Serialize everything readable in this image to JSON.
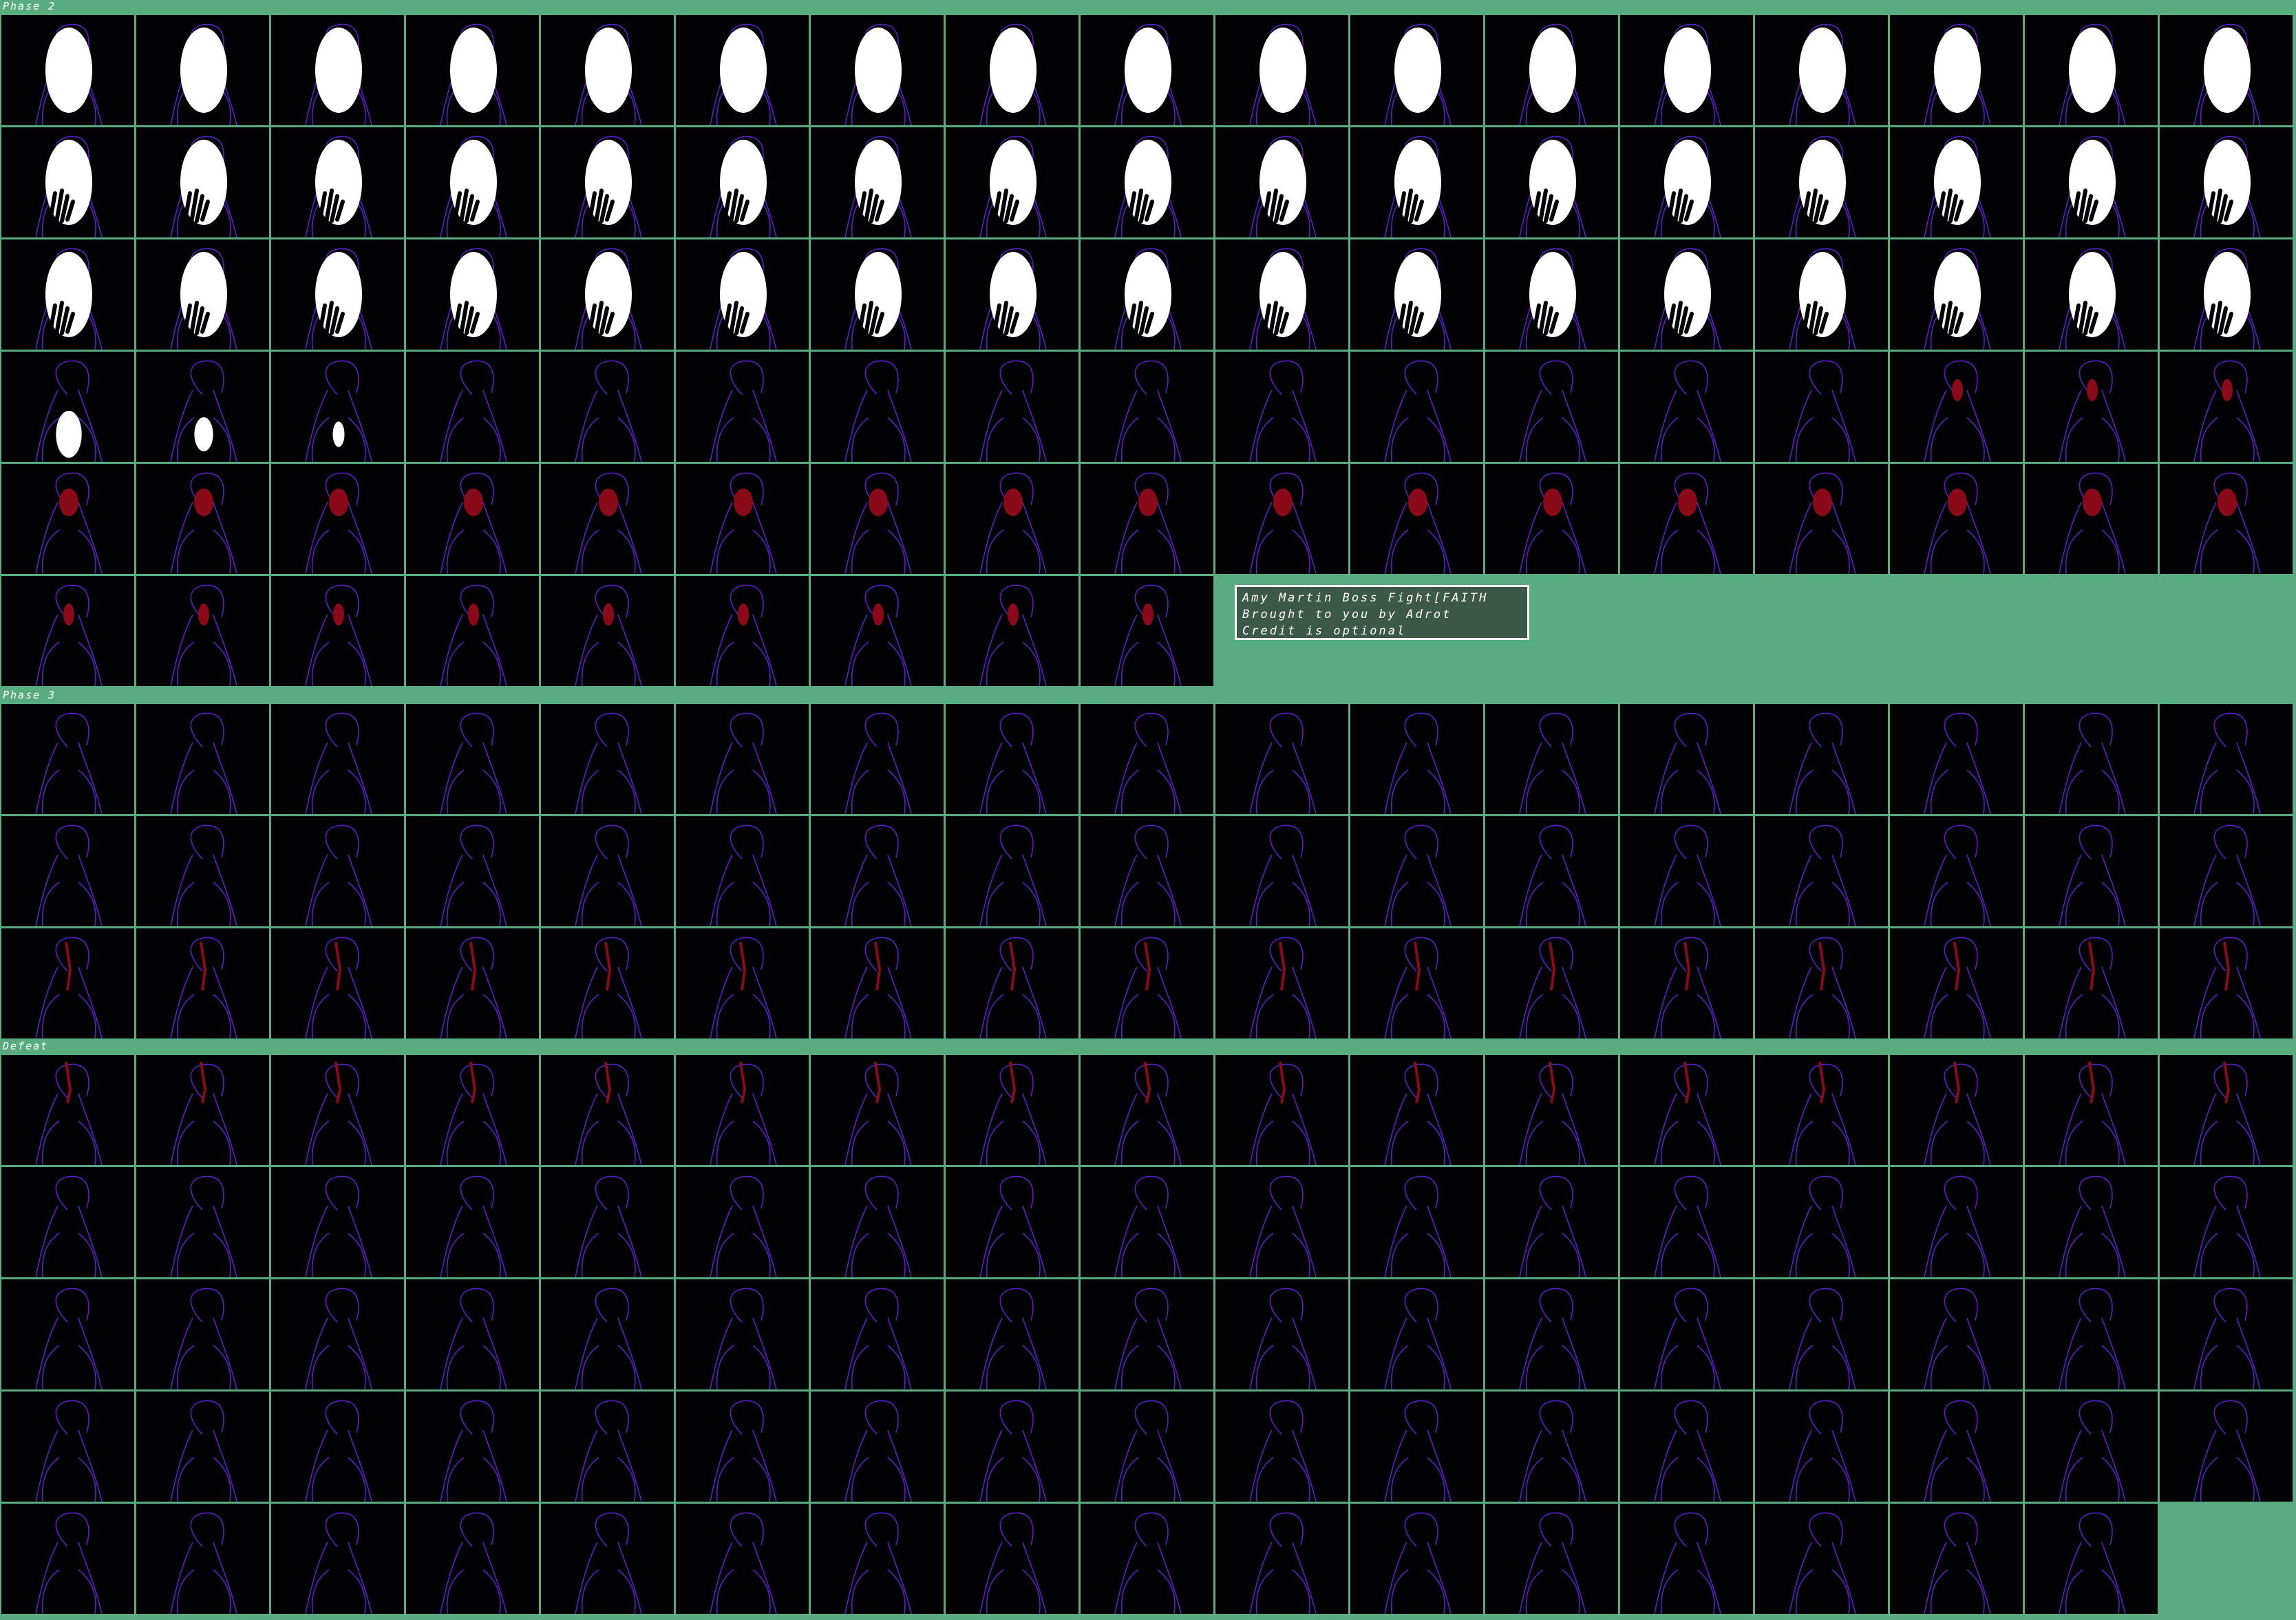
{
  "sheet": {
    "background": "#58ac80",
    "cell_background": "#020204",
    "outline_color": "#5a1fc8",
    "blood_color": "#8b0a1a",
    "mask_color": "#ffffff"
  },
  "sections": [
    {
      "label": "Phase 2",
      "rows": 6,
      "last_row_frames": 9
    },
    {
      "label": "Phase 3",
      "rows": 3,
      "last_row_frames": 17
    },
    {
      "label": "Defeat",
      "rows": 5,
      "last_row_frames": 16
    }
  ],
  "credit": {
    "line1": "Amy Martin Boss Fight[FAITH",
    "line2": "Brought to you by Adrot",
    "line3": "Credit is optional"
  }
}
